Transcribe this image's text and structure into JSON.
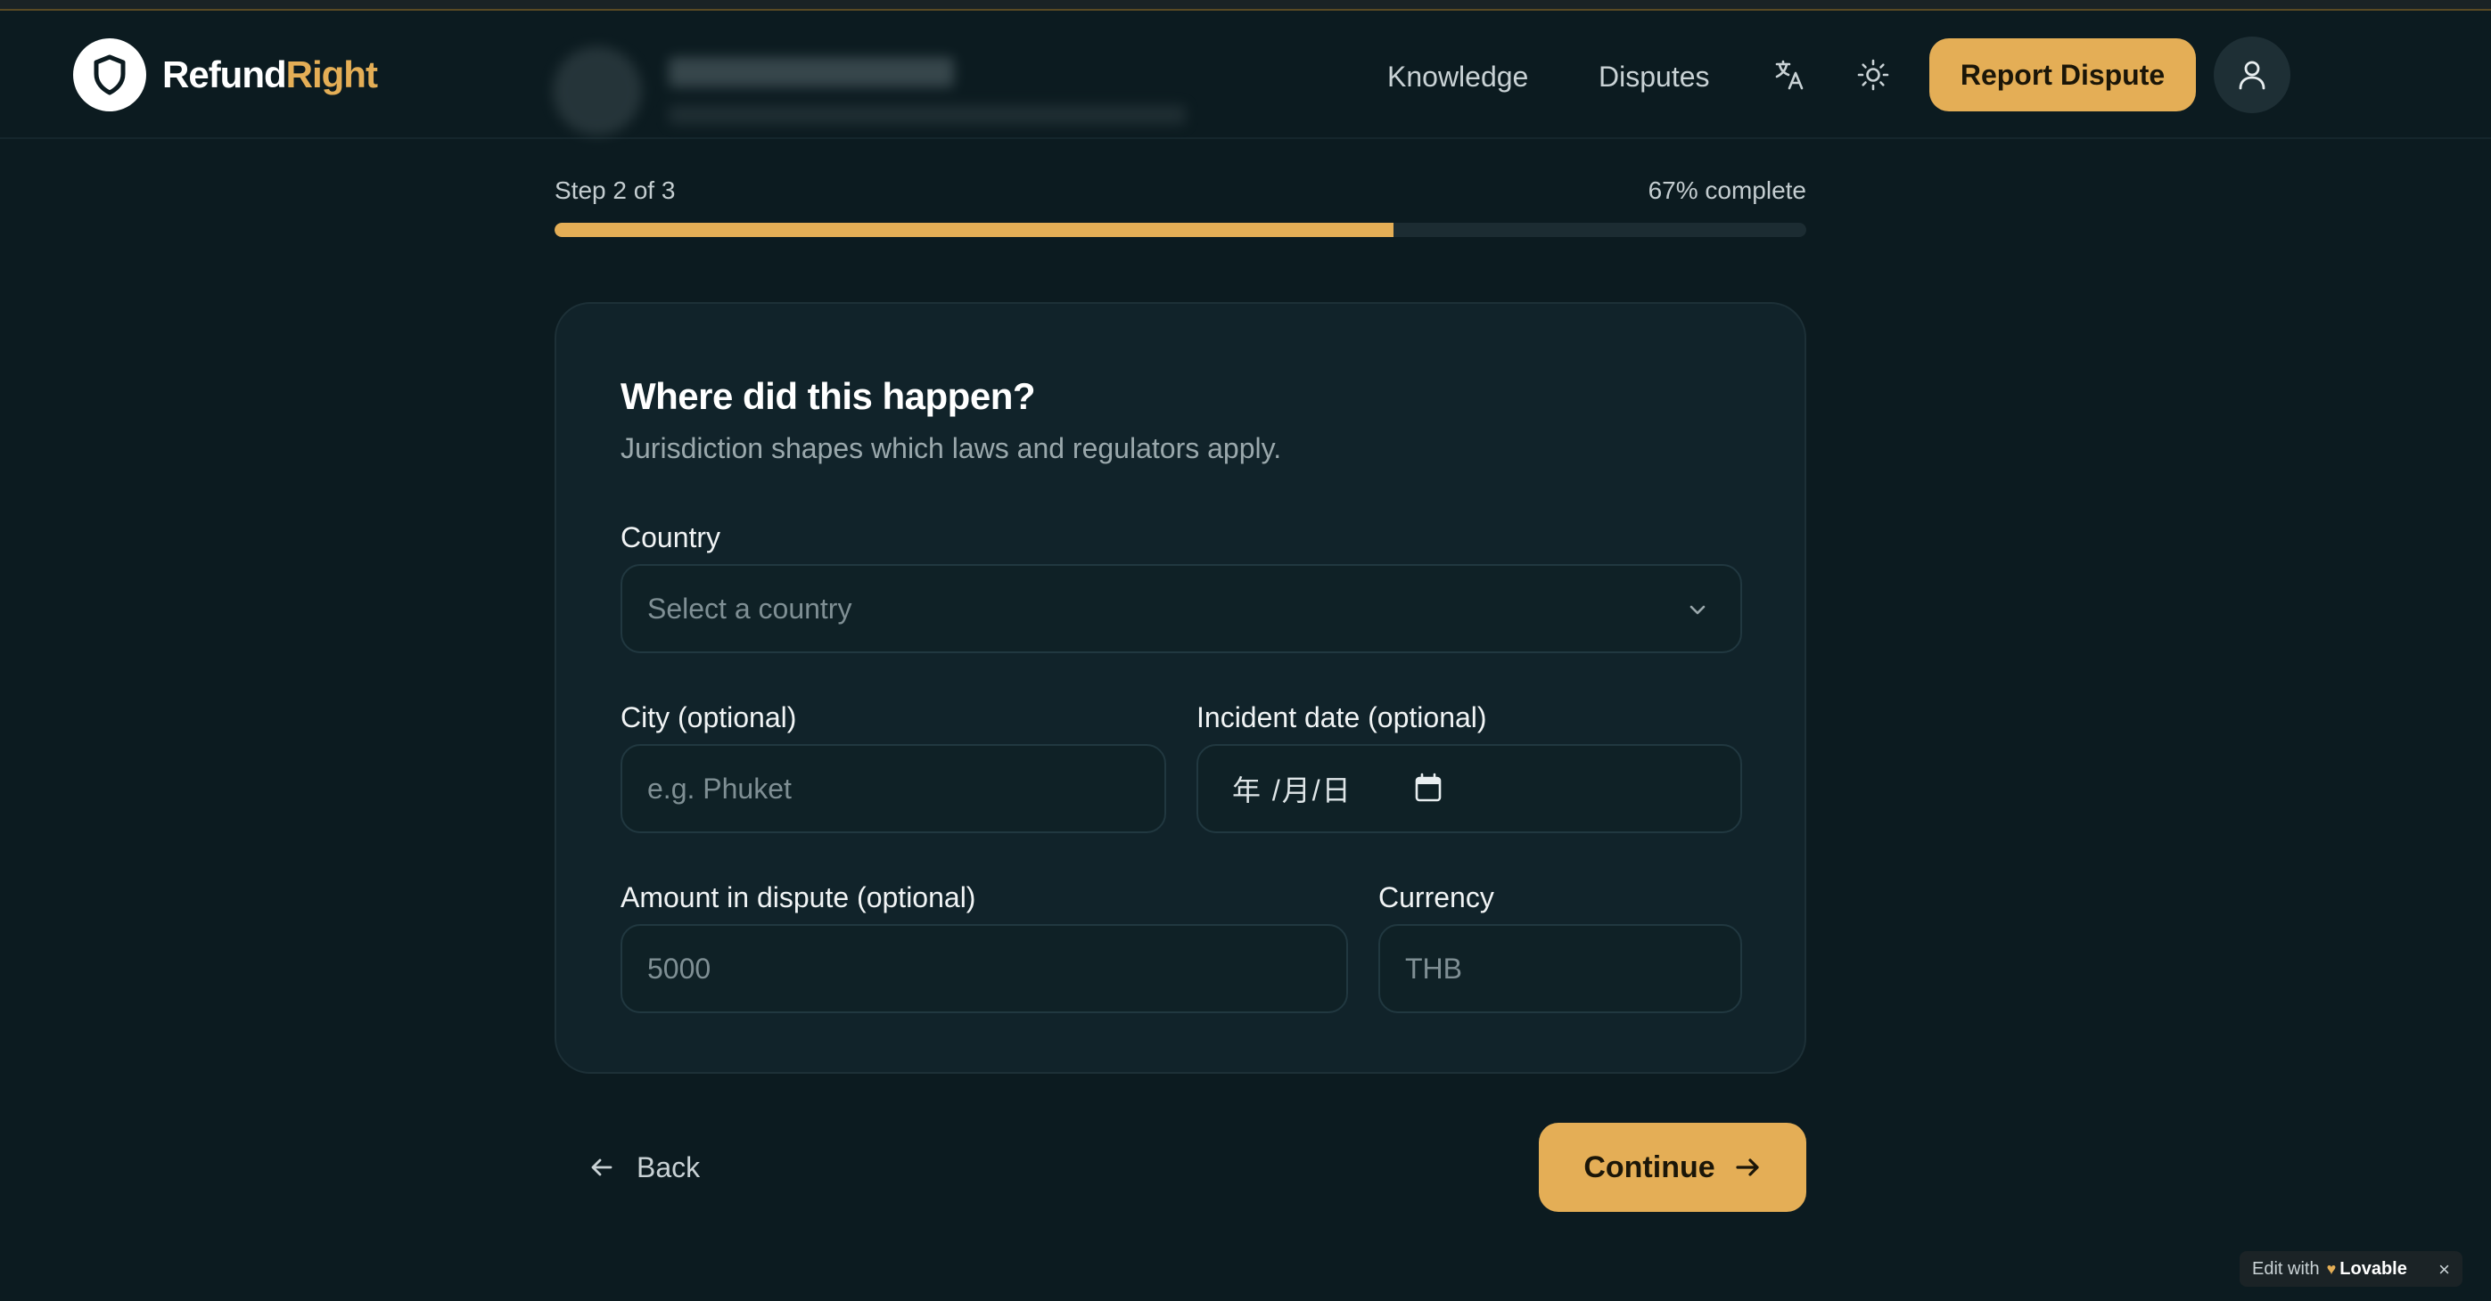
{
  "brand": {
    "name_part1": "Refund",
    "name_part2": "Right"
  },
  "nav": {
    "links": [
      "Knowledge",
      "Disputes"
    ],
    "translate_icon": "translate-icon",
    "theme_icon": "sun-icon",
    "report_button": "Report Dispute",
    "account_icon": "user-icon"
  },
  "progress": {
    "step_text": "Step 2 of 3",
    "percent_text": "67% complete",
    "fraction": 0.67
  },
  "form": {
    "title": "Where did this happen?",
    "subtitle": "Jurisdiction shapes which laws and regulators apply.",
    "country": {
      "label": "Country",
      "placeholder": "Select a country"
    },
    "city": {
      "label": "City (optional)",
      "placeholder": "e.g. Phuket"
    },
    "incident_date": {
      "label": "Incident date (optional)",
      "placeholder": "年 /月/日"
    },
    "amount": {
      "label": "Amount in dispute (optional)",
      "placeholder": "5000"
    },
    "currency": {
      "label": "Currency",
      "placeholder": "THB"
    }
  },
  "actions": {
    "back": "Back",
    "continue": "Continue"
  },
  "badge": {
    "prefix": "Edit with",
    "brand": "Lovable"
  },
  "colors": {
    "accent": "#e4ae56",
    "background": "#0c1b20",
    "card": "#11232a"
  }
}
